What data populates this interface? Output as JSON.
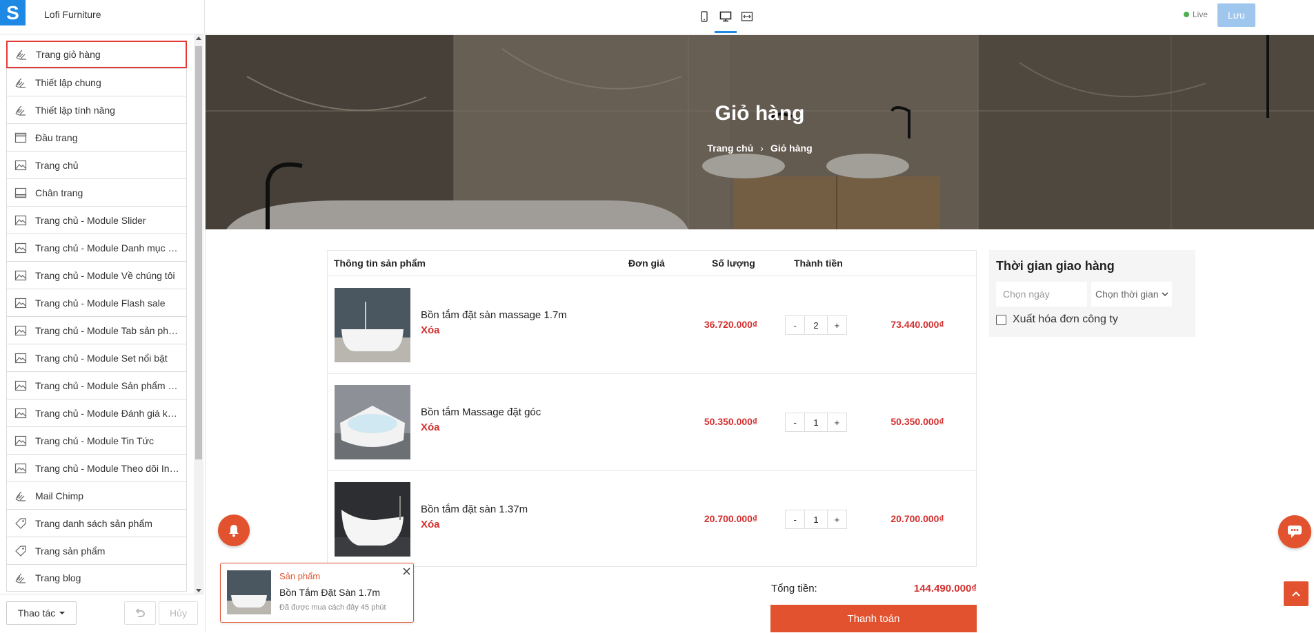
{
  "app": {
    "store_name": "Lofi Furniture",
    "logo_letter": "S"
  },
  "toolbar": {
    "live_label": "Live",
    "save_label": "Lưu"
  },
  "sidebar": {
    "items": [
      {
        "label": "Trang giỏ hàng",
        "icon": "hand-icon"
      },
      {
        "label": "Thiết lập chung",
        "icon": "hand-icon"
      },
      {
        "label": "Thiết lập tính năng",
        "icon": "hand-icon"
      },
      {
        "label": "Đầu trang",
        "icon": "header-icon"
      },
      {
        "label": "Trang chủ",
        "icon": "image-icon"
      },
      {
        "label": "Chân trang",
        "icon": "footer-icon"
      },
      {
        "label": "Trang chủ - Module Slider",
        "icon": "image-icon"
      },
      {
        "label": "Trang chủ - Module Danh mục nổi bật",
        "icon": "image-icon"
      },
      {
        "label": "Trang chủ - Module Về chúng tôi",
        "icon": "image-icon"
      },
      {
        "label": "Trang chủ - Module Flash sale",
        "icon": "image-icon"
      },
      {
        "label": "Trang chủ - Module Tab sản phẩm",
        "icon": "image-icon"
      },
      {
        "label": "Trang chủ - Module Set nổi bật",
        "icon": "image-icon"
      },
      {
        "label": "Trang chủ - Module Sản phẩm nổi bật",
        "icon": "image-icon"
      },
      {
        "label": "Trang chủ - Module Đánh giá khách hàng",
        "icon": "image-icon"
      },
      {
        "label": "Trang chủ - Module Tin Tức",
        "icon": "image-icon"
      },
      {
        "label": "Trang chủ - Module Theo dõi Instagram",
        "icon": "image-icon"
      },
      {
        "label": "Mail Chimp",
        "icon": "hand-icon"
      },
      {
        "label": "Trang danh sách sản phẩm",
        "icon": "tag-icon"
      },
      {
        "label": "Trang sản phẩm",
        "icon": "tag-icon"
      },
      {
        "label": "Trang blog",
        "icon": "hand-icon"
      }
    ],
    "footer": {
      "actions_label": "Thao tác",
      "cancel_label": "Hủy"
    }
  },
  "hero": {
    "title": "Giỏ hàng",
    "breadcrumb": [
      "Trang chủ",
      "Giỏ hàng"
    ]
  },
  "cart": {
    "headers": {
      "product": "Thông tin sản phẩm",
      "unit_price": "Đơn giá",
      "quantity": "Số lượng",
      "subtotal": "Thành tiền"
    },
    "remove_label": "Xóa",
    "items": [
      {
        "name": "Bồn tắm đặt sàn massage 1.7m",
        "price": "36.720.000₫",
        "qty": "2",
        "subtotal": "73.440.000₫"
      },
      {
        "name": "Bồn tắm Massage đặt góc",
        "price": "50.350.000₫",
        "qty": "1",
        "subtotal": "50.350.000₫"
      },
      {
        "name": "Bồn tắm đặt sàn 1.37m",
        "price": "20.700.000₫",
        "qty": "1",
        "subtotal": "20.700.000₫"
      }
    ],
    "total_label": "Tổng tiền:",
    "total_value": "144.490.000₫",
    "checkout_label": "Thanh toán"
  },
  "delivery": {
    "title": "Thời gian giao hàng",
    "date_placeholder": "Chọn ngày",
    "time_placeholder": "Chọn thời gian",
    "invoice_label": "Xuất hóa đơn công ty"
  },
  "popup": {
    "category": "Sản phẩm",
    "product_name": "Bồn Tắm Đặt Sàn 1.7m",
    "time_text": "Đã được mua cách đây 45 phút"
  },
  "colors": {
    "accent": "#1e88e5",
    "brand_orange": "#e2522e",
    "price_red": "#d32f2f",
    "active_border": "#e53935"
  }
}
